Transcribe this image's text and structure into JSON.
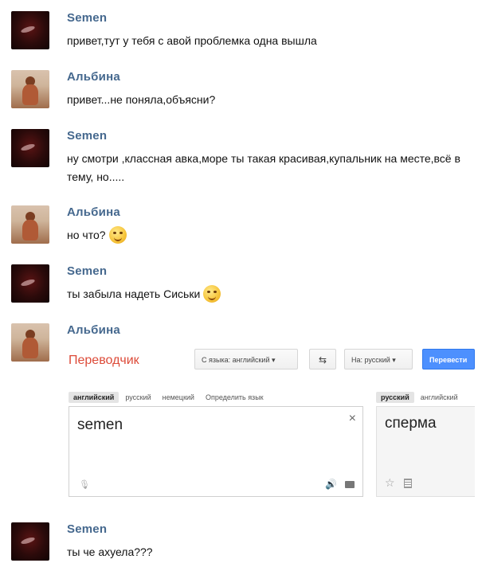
{
  "messages": [
    {
      "author": "Semen",
      "avatar": "dark-sunset-avatar",
      "text": "привет,тут у тебя с авой проблемка одна вышла"
    },
    {
      "author": "Альбина",
      "avatar": "beach-photo-avatar",
      "text": "привет...не поняла,объясни?"
    },
    {
      "author": "Semen",
      "avatar": "dark-sunset-avatar",
      "text": "ну смотри ,классная авка,море ты такая красивая,купальник на месте,всё в тему, но....."
    },
    {
      "author": "Альбина",
      "avatar": "beach-photo-avatar",
      "text": "но что?",
      "emoji": "wink-smiley"
    },
    {
      "author": "Semen",
      "avatar": "dark-sunset-avatar",
      "text": "ты забыла надеть Сиськи",
      "emoji": "smile-smiley"
    },
    {
      "author": "Альбина",
      "avatar": "beach-photo-avatar",
      "text": ""
    },
    {
      "author": "Semen",
      "avatar": "dark-sunset-avatar",
      "text": "ты че ахуела???"
    }
  ],
  "translator": {
    "title": "Переводчик",
    "from_button": "С языка: английский ▾",
    "swap_icon": "swap-arrows-icon",
    "to_button": "На: русский ▾",
    "translate_button": "Перевести",
    "source_tabs": [
      "английский",
      "русский",
      "немецкий",
      "Определить язык"
    ],
    "target_tabs": [
      "русский",
      "английский"
    ],
    "source_text": "semen",
    "translated_text": "сперма",
    "clear_label": "×",
    "colors": {
      "title": "#dd4b39",
      "button": "#4d90fe"
    }
  },
  "colors": {
    "author_name": "#45688e"
  }
}
